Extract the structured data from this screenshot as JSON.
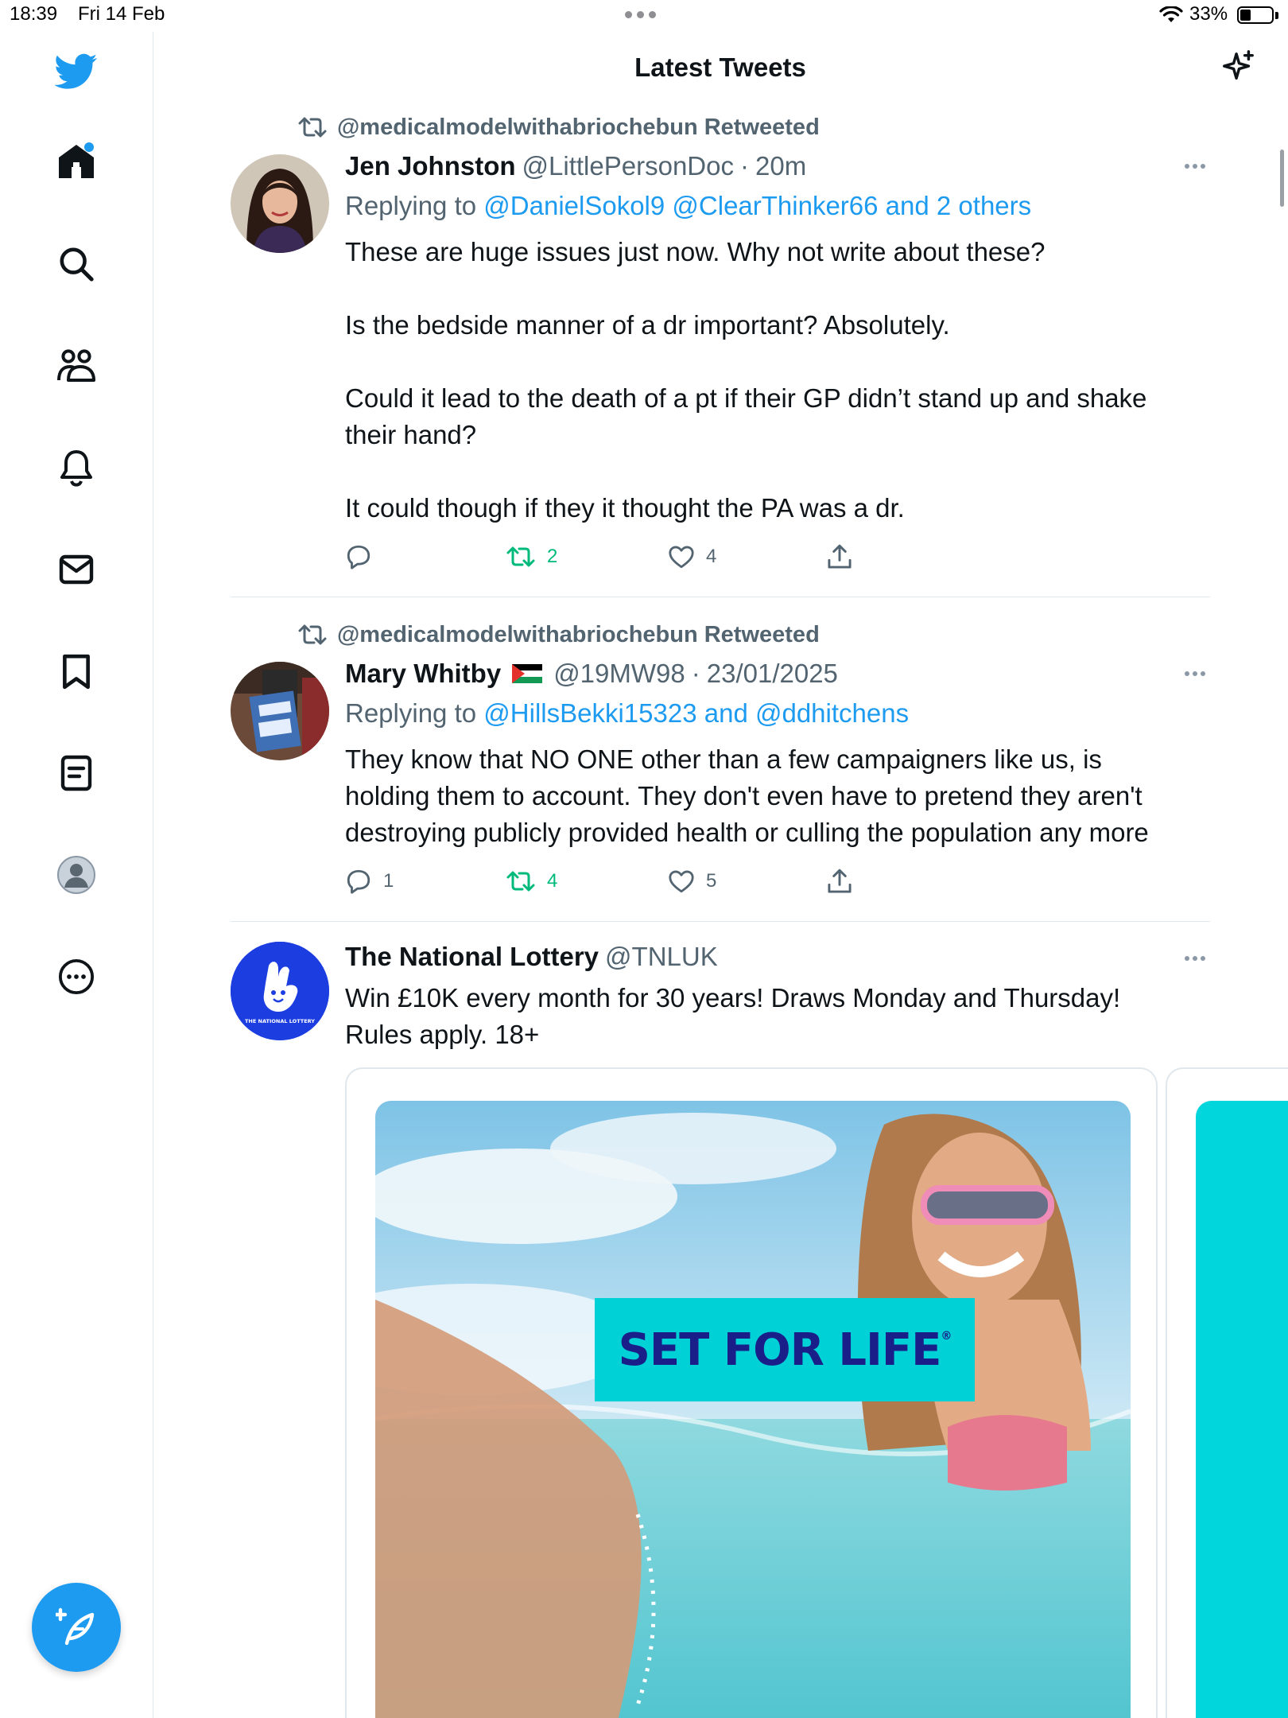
{
  "status_bar": {
    "time": "18:39",
    "date": "Fri 14 Feb",
    "battery": "33%"
  },
  "header": {
    "title": "Latest Tweets",
    "sparkle_icon": "sparkle-icon"
  },
  "sidebar": {
    "logo_icon": "twitter-bird-icon",
    "items": [
      {
        "icon": "home-icon"
      },
      {
        "icon": "search-icon"
      },
      {
        "icon": "communities-icon"
      },
      {
        "icon": "notifications-bell-icon"
      },
      {
        "icon": "messages-envelope-icon"
      },
      {
        "icon": "bookmark-icon"
      },
      {
        "icon": "lists-icon"
      },
      {
        "icon": "profile-avatar-icon"
      },
      {
        "icon": "more-circle-icon"
      }
    ],
    "compose_icon": "compose-feather-icon"
  },
  "tweets": [
    {
      "retweeted_by": "@medicalmodelwithabriochebun Retweeted",
      "name": "Jen Johnston",
      "handle": "@LittlePersonDoc",
      "time": "20m",
      "reply_prefix": "Replying to",
      "reply_targets": "@DanielSokol9 @ClearThinker66 and 2 others",
      "paragraphs": [
        "These are huge issues just now. Why not write about these?",
        "Is the bedside manner of a dr important? Absolutely.",
        "Could it lead to the death of a  pt if their GP didn’t stand up and shake their hand?",
        "It could though if they it thought the PA was a dr."
      ],
      "replies": "",
      "retweets": "2",
      "likes": "4"
    },
    {
      "retweeted_by": "@medicalmodelwithabriochebun Retweeted",
      "name": "Mary Whitby",
      "flag": "🇵🇸",
      "handle": "@19MW98",
      "time": "23/01/2025",
      "reply_prefix": "Replying to",
      "reply_targets": "@HillsBekki15323 and @ddhitchens",
      "paragraphs": [
        "They know that NO ONE other than a few campaigners like us, is holding them to account.  They don't even have to pretend they aren't destroying publicly provided health or culling the population any more"
      ],
      "replies": "1",
      "retweets": "4",
      "likes": "5"
    },
    {
      "name": "The National Lottery",
      "handle": "@TNLUK",
      "avatar_text": "THE NATIONAL LOTTERY",
      "paragraphs": [
        "Win £10K every month for 30 years! Draws Monday and Thursday! Rules apply. 18+"
      ],
      "ad_banner": "SET FOR LIFE",
      "ad_banner_mark": "®"
    }
  ],
  "colors": {
    "accent": "#1d9bf0",
    "retweet_green": "#00ba7c",
    "secondary_text": "#536471",
    "ad_cyan": "#00d1d6",
    "ad_navy": "#1a1e88",
    "lottery_blue": "#1c3ee0"
  }
}
